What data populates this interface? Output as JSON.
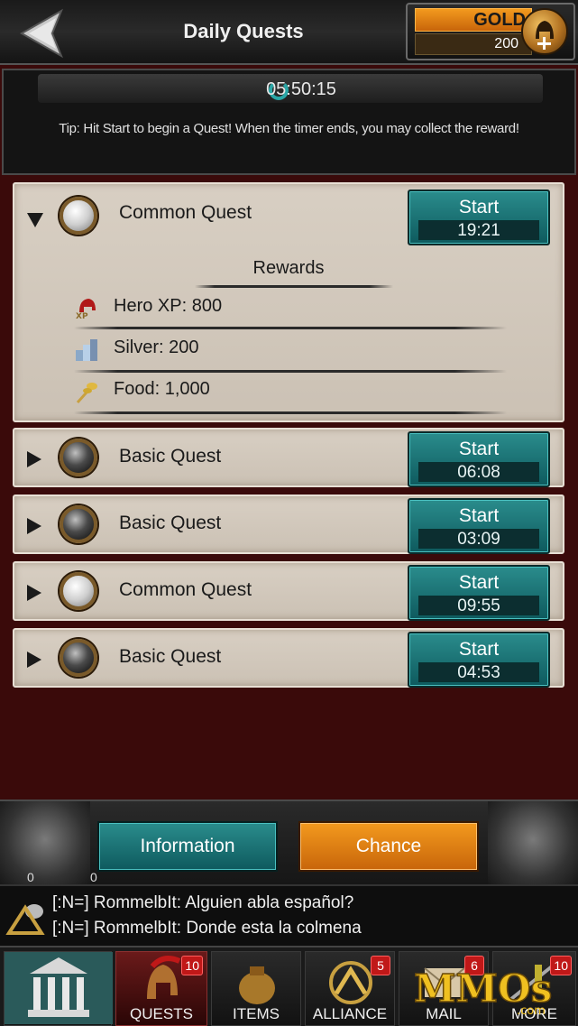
{
  "header": {
    "title": "Daily Quests",
    "back_icon": "back-arrow-icon"
  },
  "gold": {
    "label": "GOLD",
    "value": "200",
    "icon": "gold-coin-icon"
  },
  "timer": {
    "value": "05:50:15",
    "icon": "refresh-timer-icon",
    "tip": "Tip: Hit Start to begin a Quest! When the timer ends, you may collect the reward!"
  },
  "quests": [
    {
      "name": "Common Quest",
      "type": "common",
      "expanded": true,
      "button_label": "Start",
      "time": "19:21",
      "rewards_title": "Rewards",
      "rewards": [
        {
          "icon": "hero-helmet-icon",
          "label": "Hero XP: 800"
        },
        {
          "icon": "silver-coins-icon",
          "label": "Silver: 200"
        },
        {
          "icon": "food-wheat-icon",
          "label": "Food: 1,000"
        }
      ]
    },
    {
      "name": "Basic Quest",
      "type": "basic",
      "expanded": false,
      "button_label": "Start",
      "time": "06:08"
    },
    {
      "name": "Basic Quest",
      "type": "basic",
      "expanded": false,
      "button_label": "Start",
      "time": "03:09"
    },
    {
      "name": "Common Quest",
      "type": "common",
      "expanded": false,
      "button_label": "Start",
      "time": "09:55"
    },
    {
      "name": "Basic Quest",
      "type": "basic",
      "expanded": false,
      "button_label": "Start",
      "time": "04:53"
    }
  ],
  "actions": {
    "information": "Information",
    "chance": "Chance",
    "left_count": "0",
    "right_count": "0"
  },
  "chat": {
    "lines": [
      "[:N=] RommelbIt: Alguien abla español?",
      "[:N=] RommelbIt: Donde esta la colmena"
    ]
  },
  "nav": {
    "items": [
      {
        "label": "",
        "icon": "home-building-icon",
        "badge": ""
      },
      {
        "label": "QUESTS",
        "icon": "spartan-helmet-icon",
        "badge": "10"
      },
      {
        "label": "ITEMS",
        "icon": "bag-icon",
        "badge": ""
      },
      {
        "label": "ALLIANCE",
        "icon": "alliance-emblem-icon",
        "badge": "5"
      },
      {
        "label": "MAIL",
        "icon": "mail-icon",
        "badge": "6"
      },
      {
        "label": "MORE",
        "icon": "more-icon",
        "badge": "10"
      }
    ],
    "watermark": "MMOs.com"
  },
  "colors": {
    "background": "#3a0a0a",
    "teal_button": "#0e5a5e",
    "orange_button": "#c8650a",
    "card": "#d8cfc3"
  }
}
